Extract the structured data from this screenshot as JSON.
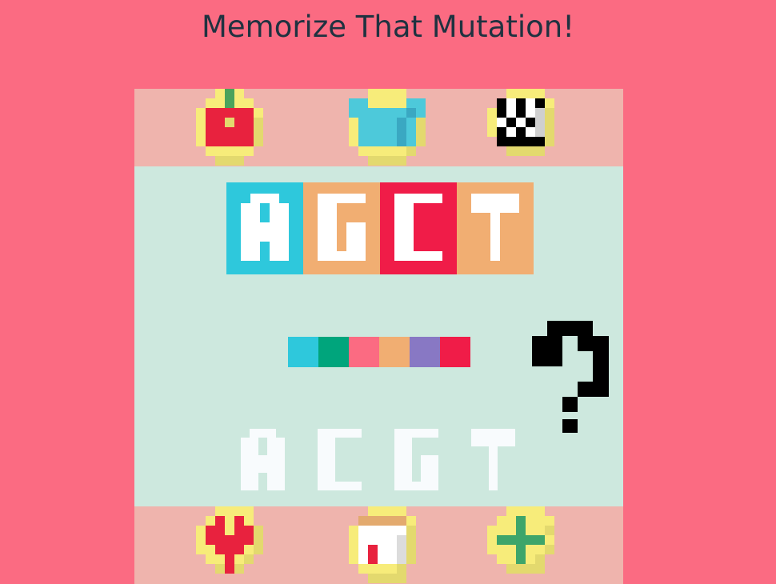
{
  "title": "Memorize That Mutation!",
  "colors": {
    "background": "#fb6b82",
    "board": "#cde8de",
    "band": "#efb4ad",
    "yellow": "#f7ec7a",
    "cyan": "#2ec8dc",
    "orange": "#f1ae72",
    "red": "#f01c48",
    "green": "#00a57c",
    "purple": "#8878c4"
  },
  "top_icons": [
    {
      "name": "apple-icon"
    },
    {
      "name": "shirt-icon"
    },
    {
      "name": "checkerboard-icon"
    }
  ],
  "bottom_icons": [
    {
      "name": "heart-icon"
    },
    {
      "name": "jar-icon"
    },
    {
      "name": "plus-icon"
    }
  ],
  "target_sequence": [
    {
      "letter": "A",
      "color": "#2ec8dc",
      "text_color": "#ffffff"
    },
    {
      "letter": "G",
      "color": "#f1ae72",
      "text_color": "#ffffff"
    },
    {
      "letter": "C",
      "color": "#f01c48",
      "text_color": "#ffffff"
    },
    {
      "letter": "T",
      "color": "#f1ae72",
      "text_color": "#ffffff"
    }
  ],
  "color_bar": [
    "#2ec8dc",
    "#00a57c",
    "#fb6b82",
    "#f1ae72",
    "#8878c4",
    "#f01c48"
  ],
  "answer_sequence": [
    "A",
    "C",
    "G",
    "T"
  ],
  "question_mark_icon": "question-mark-icon"
}
